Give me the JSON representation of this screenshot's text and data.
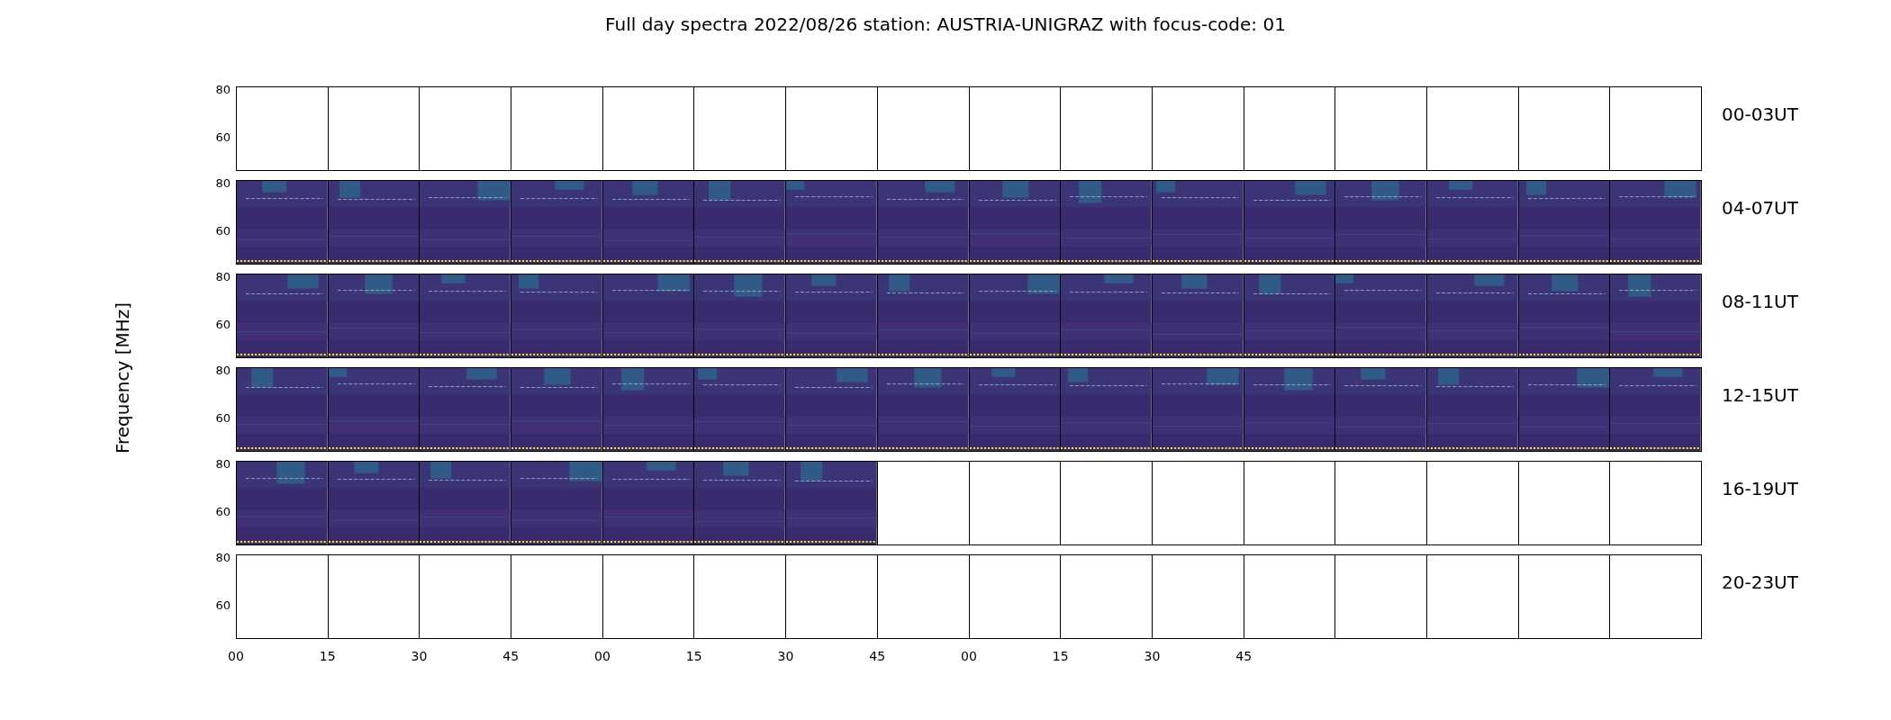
{
  "title": "Full day spectra 2022/08/26 station: AUSTRIA-UNIGRAZ with focus-code: 01",
  "ylabel": "Frequency [MHz]",
  "rows": [
    {
      "label": "00-03UT",
      "yticks": [
        "80",
        "60"
      ],
      "panels": [
        {
          "kind": "empty"
        },
        {
          "kind": "empty"
        },
        {
          "kind": "empty"
        },
        {
          "kind": "empty"
        },
        {
          "kind": "empty"
        },
        {
          "kind": "empty"
        },
        {
          "kind": "empty"
        },
        {
          "kind": "empty"
        },
        {
          "kind": "empty"
        },
        {
          "kind": "empty"
        },
        {
          "kind": "empty"
        },
        {
          "kind": "empty"
        },
        {
          "kind": "empty"
        },
        {
          "kind": "empty"
        },
        {
          "kind": "empty"
        },
        {
          "kind": "empty"
        }
      ]
    },
    {
      "label": "04-07UT",
      "yticks": [
        "80",
        "60"
      ],
      "panels": [
        {
          "kind": "spectrum"
        },
        {
          "kind": "spectrum"
        },
        {
          "kind": "spectrum"
        },
        {
          "kind": "spectrum"
        },
        {
          "kind": "spectrum"
        },
        {
          "kind": "spectrum"
        },
        {
          "kind": "spectrum"
        },
        {
          "kind": "spectrum"
        },
        {
          "kind": "spectrum"
        },
        {
          "kind": "spectrum"
        },
        {
          "kind": "spectrum"
        },
        {
          "kind": "spectrum"
        },
        {
          "kind": "spectrum"
        },
        {
          "kind": "spectrum"
        },
        {
          "kind": "spectrum"
        },
        {
          "kind": "spectrum"
        }
      ]
    },
    {
      "label": "08-11UT",
      "yticks": [
        "80",
        "60"
      ],
      "panels": [
        {
          "kind": "spectrum"
        },
        {
          "kind": "spectrum"
        },
        {
          "kind": "spectrum"
        },
        {
          "kind": "spectrum"
        },
        {
          "kind": "spectrum"
        },
        {
          "kind": "spectrum"
        },
        {
          "kind": "spectrum"
        },
        {
          "kind": "spectrum"
        },
        {
          "kind": "spectrum"
        },
        {
          "kind": "spectrum"
        },
        {
          "kind": "spectrum"
        },
        {
          "kind": "spectrum"
        },
        {
          "kind": "spectrum"
        },
        {
          "kind": "spectrum"
        },
        {
          "kind": "spectrum"
        },
        {
          "kind": "spectrum"
        }
      ]
    },
    {
      "label": "12-15UT",
      "yticks": [
        "80",
        "60"
      ],
      "panels": [
        {
          "kind": "spectrum"
        },
        {
          "kind": "spectrum"
        },
        {
          "kind": "spectrum"
        },
        {
          "kind": "spectrum"
        },
        {
          "kind": "spectrum"
        },
        {
          "kind": "spectrum"
        },
        {
          "kind": "spectrum"
        },
        {
          "kind": "spectrum"
        },
        {
          "kind": "spectrum"
        },
        {
          "kind": "spectrum"
        },
        {
          "kind": "spectrum"
        },
        {
          "kind": "spectrum"
        },
        {
          "kind": "spectrum"
        },
        {
          "kind": "spectrum"
        },
        {
          "kind": "spectrum"
        },
        {
          "kind": "spectrum"
        }
      ]
    },
    {
      "label": "16-19UT",
      "yticks": [
        "80",
        "60"
      ],
      "panels": [
        {
          "kind": "spectrum"
        },
        {
          "kind": "spectrum"
        },
        {
          "kind": "spectrum"
        },
        {
          "kind": "spectrum"
        },
        {
          "kind": "spectrum"
        },
        {
          "kind": "spectrum"
        },
        {
          "kind": "spectrum"
        },
        {
          "kind": "empty"
        },
        {
          "kind": "empty"
        },
        {
          "kind": "empty"
        },
        {
          "kind": "empty"
        },
        {
          "kind": "empty"
        },
        {
          "kind": "empty"
        },
        {
          "kind": "empty"
        },
        {
          "kind": "empty"
        },
        {
          "kind": "empty"
        }
      ]
    },
    {
      "label": "20-23UT",
      "yticks": [
        "80",
        "60"
      ],
      "panels": [
        {
          "kind": "empty"
        },
        {
          "kind": "empty"
        },
        {
          "kind": "empty"
        },
        {
          "kind": "empty"
        },
        {
          "kind": "empty"
        },
        {
          "kind": "empty"
        },
        {
          "kind": "empty"
        },
        {
          "kind": "empty"
        },
        {
          "kind": "empty"
        },
        {
          "kind": "empty"
        },
        {
          "kind": "empty"
        },
        {
          "kind": "empty"
        },
        {
          "kind": "empty"
        },
        {
          "kind": "empty"
        },
        {
          "kind": "empty"
        },
        {
          "kind": "empty"
        }
      ]
    }
  ],
  "xticks": [
    "00",
    "15",
    "30",
    "45",
    "00",
    "15",
    "30",
    "45",
    "00",
    "15",
    "30",
    "45"
  ]
}
